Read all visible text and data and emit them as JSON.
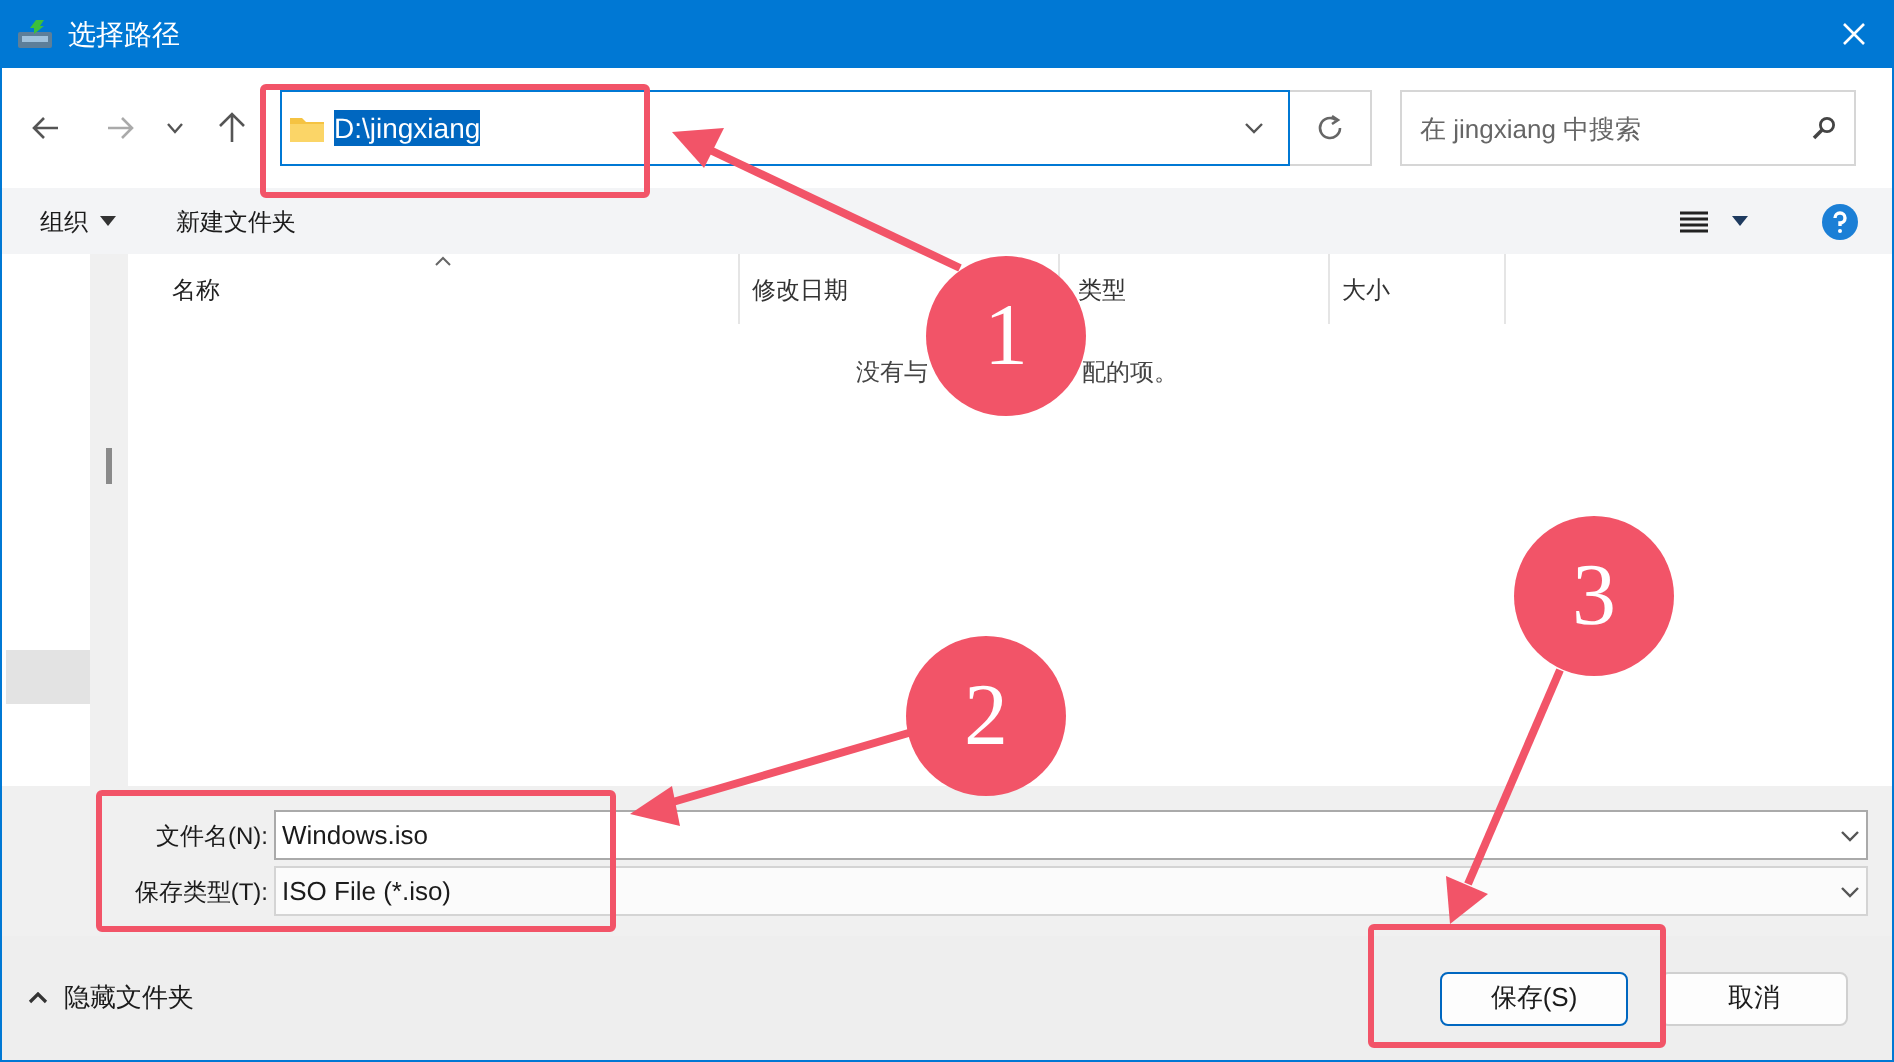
{
  "window": {
    "title": "选择路径"
  },
  "address_bar": {
    "value": "D:\\jingxiang",
    "selected": true
  },
  "search": {
    "placeholder": "在 jingxiang 中搜索"
  },
  "toolbar": {
    "organize": "组织",
    "new_folder": "新建文件夹"
  },
  "columns": [
    {
      "label": "名称",
      "sorted": true
    },
    {
      "label": "修改日期",
      "sorted": false
    },
    {
      "label": "类型",
      "sorted": false
    },
    {
      "label": "大小",
      "sorted": false
    }
  ],
  "empty_message": [
    "没有与",
    "配的项。"
  ],
  "file_name": {
    "label": "文件名(N):",
    "value": "Windows.iso"
  },
  "save_type": {
    "label": "保存类型(T):",
    "value": "ISO File (*.iso)"
  },
  "hide_folders": "隐藏文件夹",
  "buttons": [
    {
      "label": "保存(S)",
      "default": true
    },
    {
      "label": "取消",
      "default": false
    }
  ],
  "annotations": [
    {
      "number": "1"
    },
    {
      "number": "2"
    },
    {
      "number": "3"
    }
  ]
}
